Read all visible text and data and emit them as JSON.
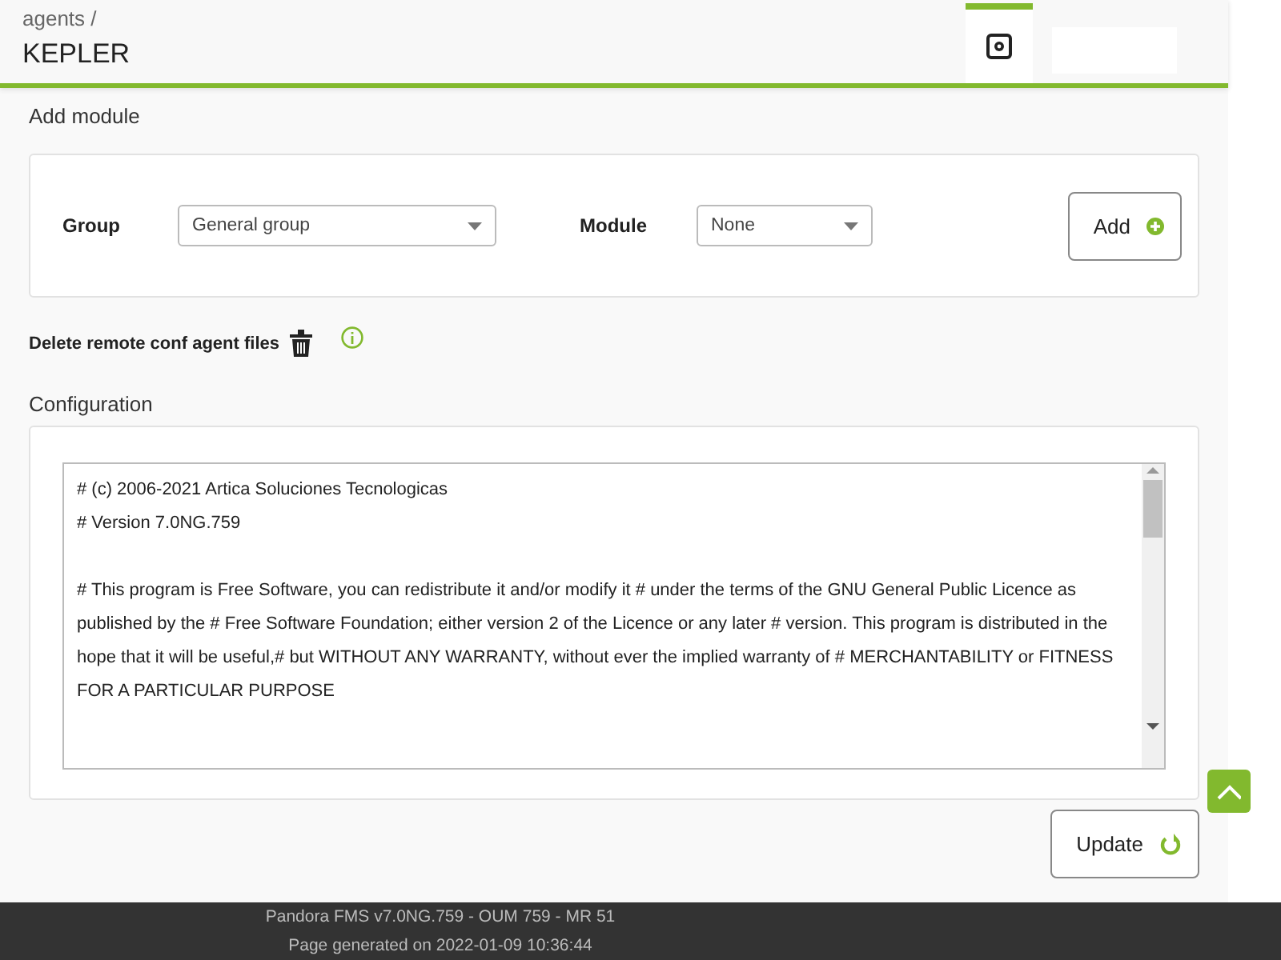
{
  "breadcrumb": "agents /",
  "title": "KEPLER",
  "header_tabs": [
    {
      "kind": "gear",
      "selected": true
    }
  ],
  "add_module": {
    "heading": "Add module",
    "group_label": "Group",
    "group_value": "General group",
    "module_label": "Module",
    "module_value": "None",
    "button": "Add"
  },
  "delete_label": "Delete remote conf agent files",
  "configuration": {
    "heading": "Configuration",
    "paragraphs": [
      [
        "# (c) 2006-2021 Artica Soluciones Tecnologicas",
        "# Version 7.0NG.759"
      ],
      [
        "# This program is Free Software, you can redistribute it and/or modify it # under the terms of the GNU General Public Licence as published by the # Free Software Foundation; either version 2 of the Licence or any later # version. This program is distributed in the hope that it will be useful,# but WITHOUT ANY WARRANTY, without ever the implied warranty of # MERCHANTABILITY or FITNESS FOR A PARTICULAR PURPOSE"
      ]
    ]
  },
  "update_button": "Update",
  "footer": [
    "Pandora FMS v7.0NG.759 - OUM 759 - MR 51",
    "Page generated on 2022-01-09 10:36:44"
  ]
}
